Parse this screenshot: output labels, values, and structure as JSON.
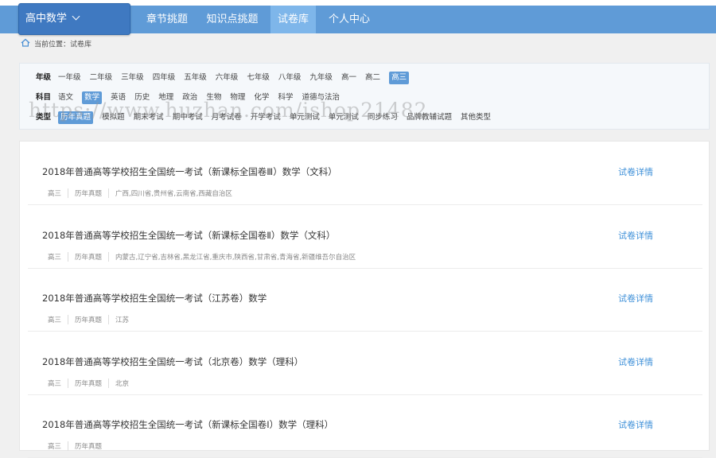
{
  "header": {
    "subject": "高中数学",
    "nav": [
      "章节挑题",
      "知识点挑题",
      "试卷库",
      "个人中心"
    ],
    "active_nav": "试卷库"
  },
  "breadcrumb": "当前位置：试卷库",
  "filters": {
    "grade": {
      "label": "年级",
      "options": [
        "一年级",
        "二年级",
        "三年级",
        "四年级",
        "五年级",
        "六年级",
        "七年级",
        "八年级",
        "九年级",
        "高一",
        "高二",
        "高三"
      ],
      "selected": "高三"
    },
    "subject": {
      "label": "科目",
      "options": [
        "语文",
        "数学",
        "英语",
        "历史",
        "地理",
        "政治",
        "生物",
        "物理",
        "化学",
        "科学",
        "道德与法治"
      ],
      "selected": "数学"
    },
    "type": {
      "label": "类型",
      "options": [
        "历年真题",
        "模拟题",
        "期末考试",
        "期中考试",
        "月考试卷",
        "开学考试",
        "单元测试",
        "单元测试",
        "同步练习",
        "品牌教辅试题",
        "其他类型"
      ],
      "selected": "历年真题"
    }
  },
  "watermark": "https://www.huzhan.com/ishop21482",
  "papers": [
    {
      "title": "2018年普通高等学校招生全国统一考试（新课标全国卷Ⅲ）数学（文科）",
      "grade": "高三",
      "type": "历年真题",
      "region": "广西,四川省,贵州省,云南省,西藏自治区",
      "detail": "试卷详情"
    },
    {
      "title": "2018年普通高等学校招生全国统一考试（新课标全国卷Ⅱ）数学（文科）",
      "grade": "高三",
      "type": "历年真题",
      "region": "内蒙古,辽宁省,吉林省,黑龙江省,重庆市,陕西省,甘肃省,青海省,新疆维吾尔自治区",
      "detail": "试卷详情"
    },
    {
      "title": "2018年普通高等学校招生全国统一考试（江苏卷）数学",
      "grade": "高三",
      "type": "历年真题",
      "region": "江苏",
      "detail": "试卷详情"
    },
    {
      "title": "2018年普通高等学校招生全国统一考试（北京卷）数学（理科）",
      "grade": "高三",
      "type": "历年真题",
      "region": "北京",
      "detail": "试卷详情"
    },
    {
      "title": "2018年普通高等学校招生全国统一考试（新课标全国卷Ⅰ）数学（理科）",
      "grade": "高三",
      "type": "历年真题",
      "region": "",
      "detail": "试卷详情"
    }
  ],
  "colors": {
    "nav": "#5f9bd7",
    "nav_active": "#7eb6ea",
    "link": "#3d8fd8"
  },
  "icons": {
    "home": "home-icon",
    "dropdown": "chevron-down-icon"
  }
}
